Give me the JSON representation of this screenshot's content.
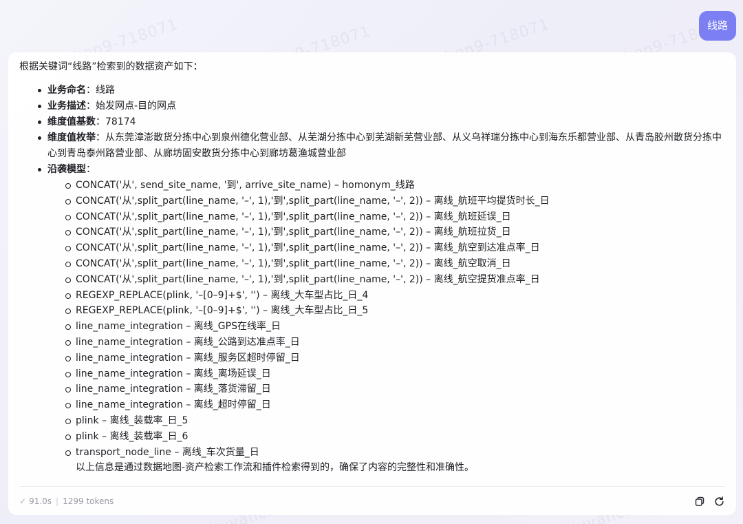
{
  "user_message": "线路",
  "answer": {
    "intro": "根据关键词“线路”检索到的数据资产如下：",
    "items": [
      {
        "label": "业务命名",
        "value": "线路"
      },
      {
        "label": "业务描述",
        "value": "始发网点-目的网点"
      },
      {
        "label": "维度值基数",
        "value": "78174"
      },
      {
        "label": "维度值枚举",
        "value": "从东莞漳澎散货分拣中心到泉州德化营业部、从芜湖分拣中心到芜湖新芜营业部、从义乌祥瑞分拣中心到海东乐都营业部、从青岛胶州散货分拣中心到青岛泰州路营业部、从廊坊固安散货分拣中心到廊坊葛渔城营业部"
      },
      {
        "label": "沿袭模型",
        "value": ""
      }
    ],
    "lineage_models": [
      "CONCAT('从', send_site_name, '到', arrive_site_name) – homonym_线路",
      "CONCAT('从',split_part(line_name, '–', 1),'到',split_part(line_name, '–', 2)) – 离线_航班平均提货时长_日",
      "CONCAT('从',split_part(line_name, '–', 1),'到',split_part(line_name, '–', 2)) – 离线_航班延误_日",
      "CONCAT('从',split_part(line_name, '–', 1),'到',split_part(line_name, '–', 2)) – 离线_航班拉货_日",
      "CONCAT('从',split_part(line_name, '–', 1),'到',split_part(line_name, '–', 2)) – 离线_航空到达准点率_日",
      "CONCAT('从',split_part(line_name, '–', 1),'到',split_part(line_name, '–', 2)) – 离线_航空取消_日",
      "CONCAT('从',split_part(line_name, '–', 1),'到',split_part(line_name, '–', 2)) – 离线_航空提货准点率_日",
      "REGEXP_REPLACE(plink, '–[0–9]+$', '') – 离线_大车型占比_日_4",
      "REGEXP_REPLACE(plink, '–[0–9]+$', '') – 离线_大车型占比_日_5",
      "line_name_integration – 离线_GPS在线率_日",
      "line_name_integration – 离线_公路到达准点率_日",
      "line_name_integration – 离线_服务区超时停留_日",
      "line_name_integration – 离线_离场延误_日",
      "line_name_integration – 离线_落货滞留_日",
      "line_name_integration – 离线_超时停留_日",
      "plink – 离线_装载率_日_5",
      "plink – 离线_装载率_日_6",
      "transport_node_line – 离线_车次货量_日"
    ],
    "closing": "以上信息是通过数据地图-资产检索工作流和插件检索得到的，确保了内容的完整性和准确性。"
  },
  "footer": {
    "duration": "91.0s",
    "tokens": "1299 tokens",
    "copy_icon": "copy-icon",
    "refresh_icon": "refresh-icon"
  },
  "watermark_text": "liuyanchen9-718071"
}
